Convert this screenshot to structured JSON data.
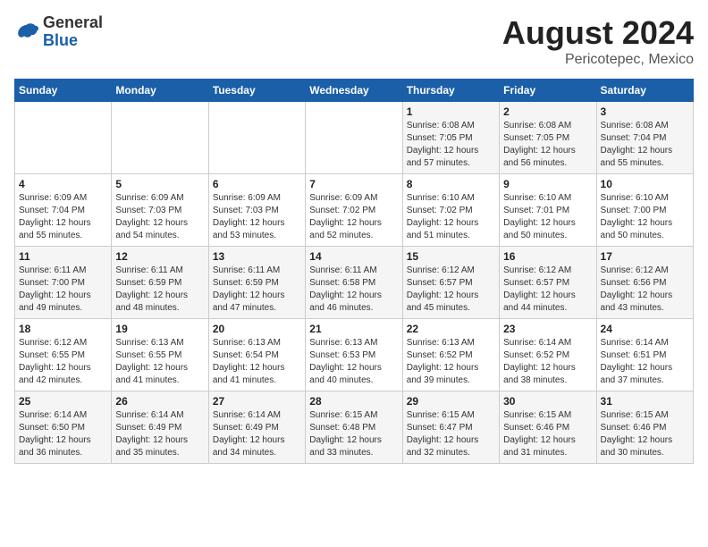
{
  "header": {
    "logo": {
      "general": "General",
      "blue": "Blue"
    },
    "title": "August 2024",
    "location": "Pericotepec, Mexico"
  },
  "weekdays": [
    "Sunday",
    "Monday",
    "Tuesday",
    "Wednesday",
    "Thursday",
    "Friday",
    "Saturday"
  ],
  "weeks": [
    [
      {
        "day": "",
        "info": ""
      },
      {
        "day": "",
        "info": ""
      },
      {
        "day": "",
        "info": ""
      },
      {
        "day": "",
        "info": ""
      },
      {
        "day": "1",
        "info": "Sunrise: 6:08 AM\nSunset: 7:05 PM\nDaylight: 12 hours\nand 57 minutes."
      },
      {
        "day": "2",
        "info": "Sunrise: 6:08 AM\nSunset: 7:05 PM\nDaylight: 12 hours\nand 56 minutes."
      },
      {
        "day": "3",
        "info": "Sunrise: 6:08 AM\nSunset: 7:04 PM\nDaylight: 12 hours\nand 55 minutes."
      }
    ],
    [
      {
        "day": "4",
        "info": "Sunrise: 6:09 AM\nSunset: 7:04 PM\nDaylight: 12 hours\nand 55 minutes."
      },
      {
        "day": "5",
        "info": "Sunrise: 6:09 AM\nSunset: 7:03 PM\nDaylight: 12 hours\nand 54 minutes."
      },
      {
        "day": "6",
        "info": "Sunrise: 6:09 AM\nSunset: 7:03 PM\nDaylight: 12 hours\nand 53 minutes."
      },
      {
        "day": "7",
        "info": "Sunrise: 6:09 AM\nSunset: 7:02 PM\nDaylight: 12 hours\nand 52 minutes."
      },
      {
        "day": "8",
        "info": "Sunrise: 6:10 AM\nSunset: 7:02 PM\nDaylight: 12 hours\nand 51 minutes."
      },
      {
        "day": "9",
        "info": "Sunrise: 6:10 AM\nSunset: 7:01 PM\nDaylight: 12 hours\nand 50 minutes."
      },
      {
        "day": "10",
        "info": "Sunrise: 6:10 AM\nSunset: 7:00 PM\nDaylight: 12 hours\nand 50 minutes."
      }
    ],
    [
      {
        "day": "11",
        "info": "Sunrise: 6:11 AM\nSunset: 7:00 PM\nDaylight: 12 hours\nand 49 minutes."
      },
      {
        "day": "12",
        "info": "Sunrise: 6:11 AM\nSunset: 6:59 PM\nDaylight: 12 hours\nand 48 minutes."
      },
      {
        "day": "13",
        "info": "Sunrise: 6:11 AM\nSunset: 6:59 PM\nDaylight: 12 hours\nand 47 minutes."
      },
      {
        "day": "14",
        "info": "Sunrise: 6:11 AM\nSunset: 6:58 PM\nDaylight: 12 hours\nand 46 minutes."
      },
      {
        "day": "15",
        "info": "Sunrise: 6:12 AM\nSunset: 6:57 PM\nDaylight: 12 hours\nand 45 minutes."
      },
      {
        "day": "16",
        "info": "Sunrise: 6:12 AM\nSunset: 6:57 PM\nDaylight: 12 hours\nand 44 minutes."
      },
      {
        "day": "17",
        "info": "Sunrise: 6:12 AM\nSunset: 6:56 PM\nDaylight: 12 hours\nand 43 minutes."
      }
    ],
    [
      {
        "day": "18",
        "info": "Sunrise: 6:12 AM\nSunset: 6:55 PM\nDaylight: 12 hours\nand 42 minutes."
      },
      {
        "day": "19",
        "info": "Sunrise: 6:13 AM\nSunset: 6:55 PM\nDaylight: 12 hours\nand 41 minutes."
      },
      {
        "day": "20",
        "info": "Sunrise: 6:13 AM\nSunset: 6:54 PM\nDaylight: 12 hours\nand 41 minutes."
      },
      {
        "day": "21",
        "info": "Sunrise: 6:13 AM\nSunset: 6:53 PM\nDaylight: 12 hours\nand 40 minutes."
      },
      {
        "day": "22",
        "info": "Sunrise: 6:13 AM\nSunset: 6:52 PM\nDaylight: 12 hours\nand 39 minutes."
      },
      {
        "day": "23",
        "info": "Sunrise: 6:14 AM\nSunset: 6:52 PM\nDaylight: 12 hours\nand 38 minutes."
      },
      {
        "day": "24",
        "info": "Sunrise: 6:14 AM\nSunset: 6:51 PM\nDaylight: 12 hours\nand 37 minutes."
      }
    ],
    [
      {
        "day": "25",
        "info": "Sunrise: 6:14 AM\nSunset: 6:50 PM\nDaylight: 12 hours\nand 36 minutes."
      },
      {
        "day": "26",
        "info": "Sunrise: 6:14 AM\nSunset: 6:49 PM\nDaylight: 12 hours\nand 35 minutes."
      },
      {
        "day": "27",
        "info": "Sunrise: 6:14 AM\nSunset: 6:49 PM\nDaylight: 12 hours\nand 34 minutes."
      },
      {
        "day": "28",
        "info": "Sunrise: 6:15 AM\nSunset: 6:48 PM\nDaylight: 12 hours\nand 33 minutes."
      },
      {
        "day": "29",
        "info": "Sunrise: 6:15 AM\nSunset: 6:47 PM\nDaylight: 12 hours\nand 32 minutes."
      },
      {
        "day": "30",
        "info": "Sunrise: 6:15 AM\nSunset: 6:46 PM\nDaylight: 12 hours\nand 31 minutes."
      },
      {
        "day": "31",
        "info": "Sunrise: 6:15 AM\nSunset: 6:46 PM\nDaylight: 12 hours\nand 30 minutes."
      }
    ]
  ]
}
